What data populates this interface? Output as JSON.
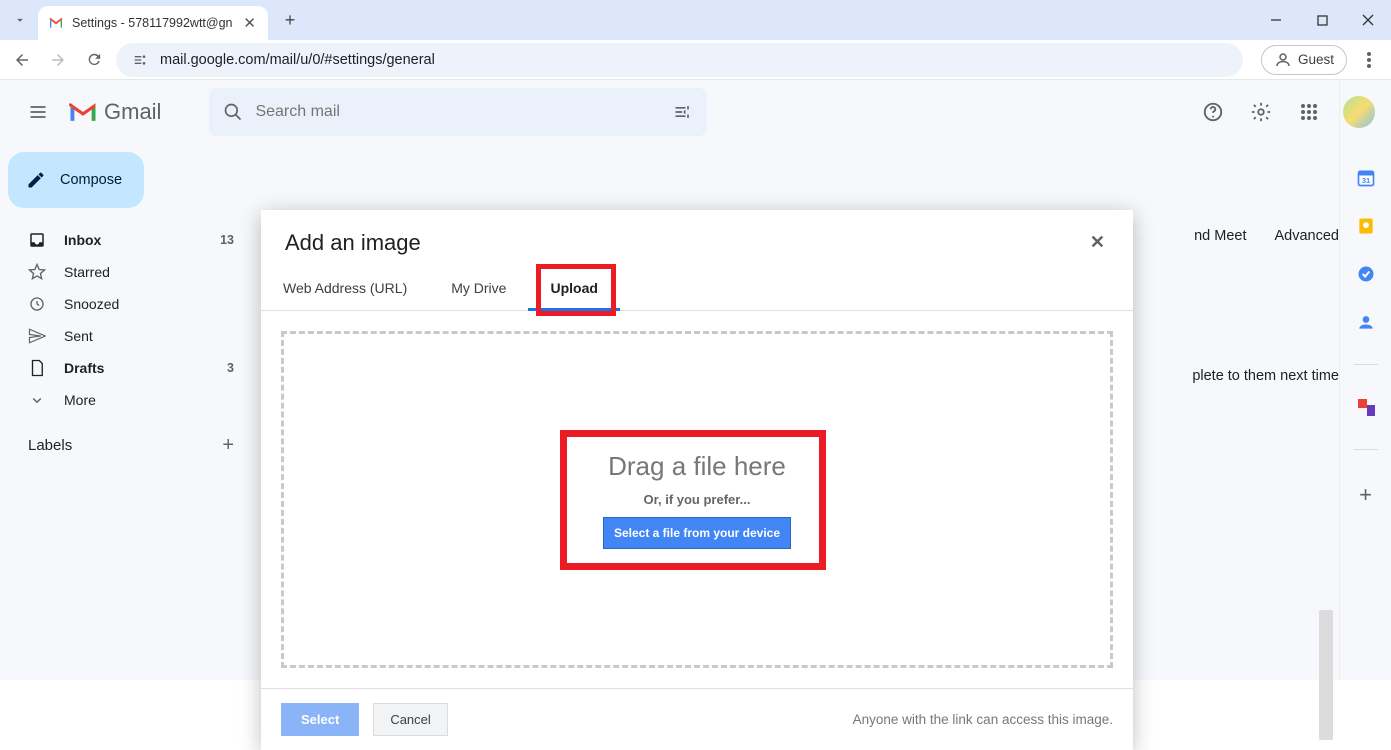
{
  "browser": {
    "tab_title": "Settings - 578117992wtt@gn",
    "url": "mail.google.com/mail/u/0/#settings/general",
    "guest_label": "Guest"
  },
  "gmail": {
    "logo_text": "Gmail",
    "search_placeholder": "Search mail",
    "compose": "Compose",
    "nav": [
      {
        "icon": "inbox",
        "label": "Inbox",
        "count": "13",
        "bold": true
      },
      {
        "icon": "star",
        "label": "Starred",
        "count": "",
        "bold": false
      },
      {
        "icon": "clock",
        "label": "Snoozed",
        "count": "",
        "bold": false
      },
      {
        "icon": "send",
        "label": "Sent",
        "count": "",
        "bold": false
      },
      {
        "icon": "file",
        "label": "Drafts",
        "count": "3",
        "bold": true
      },
      {
        "icon": "chev",
        "label": "More",
        "count": "",
        "bold": false
      }
    ],
    "labels_header": "Labels",
    "settings_tabs": {
      "meet": "nd Meet",
      "advanced": "Advanced"
    },
    "cut_text": "plete to them next time"
  },
  "modal": {
    "title": "Add an image",
    "tabs": {
      "url": "Web Address (URL)",
      "drive": "My Drive",
      "upload": "Upload"
    },
    "drop_title": "Drag a file here",
    "drop_or": "Or, if you prefer...",
    "drop_btn": "Select a file from your device",
    "select": "Select",
    "cancel": "Cancel",
    "note": "Anyone with the link can access this image."
  }
}
